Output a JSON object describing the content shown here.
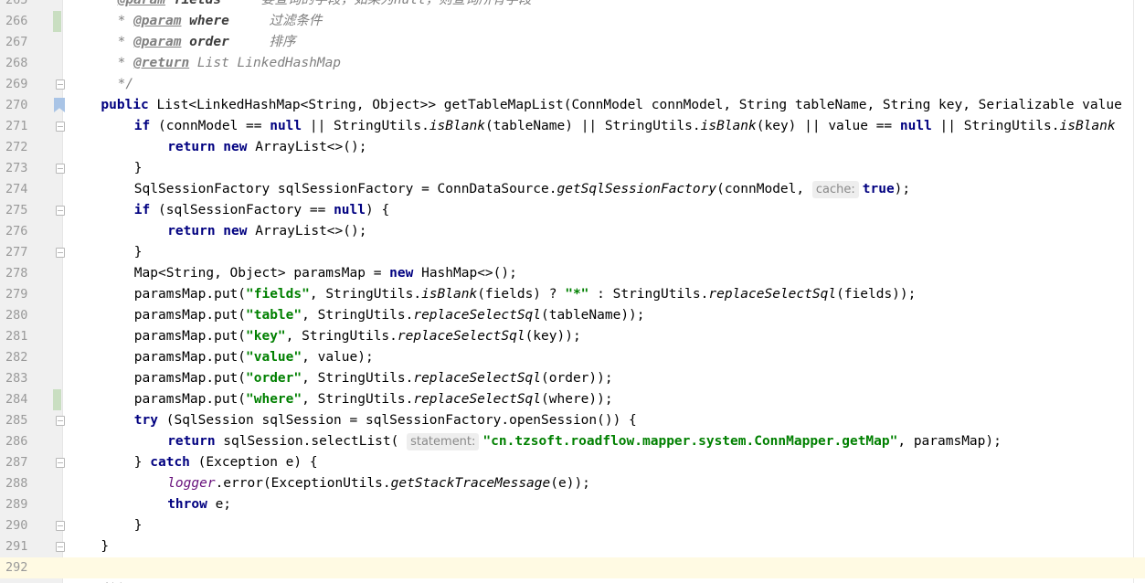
{
  "editor": {
    "lines": [
      {
        "n": "265",
        "vcs": false,
        "fold": "",
        "current": false,
        "indent": 3,
        "segments": [
          {
            "t": "tag",
            "v": "@param"
          },
          {
            "t": "tagp",
            "v": " fields"
          },
          {
            "t": "cm",
            "v": "     要查询的字段，如果为null，则查询所有字段"
          }
        ]
      },
      {
        "n": "266",
        "vcs": true,
        "fold": "",
        "current": false,
        "indent": 3,
        "segments": [
          {
            "t": "cm",
            "v": "* "
          },
          {
            "t": "tag",
            "v": "@param"
          },
          {
            "t": "tagp",
            "v": " where"
          },
          {
            "t": "cm",
            "v": "     过滤条件"
          }
        ]
      },
      {
        "n": "267",
        "vcs": false,
        "fold": "",
        "current": false,
        "indent": 3,
        "segments": [
          {
            "t": "cm",
            "v": "* "
          },
          {
            "t": "tag",
            "v": "@param"
          },
          {
            "t": "tagp",
            "v": " order"
          },
          {
            "t": "cm",
            "v": "     排序"
          }
        ]
      },
      {
        "n": "268",
        "vcs": false,
        "fold": "",
        "current": false,
        "indent": 3,
        "segments": [
          {
            "t": "cm",
            "v": "* "
          },
          {
            "t": "tag",
            "v": "@return"
          },
          {
            "t": "cm",
            "v": " List LinkedHashMap"
          }
        ]
      },
      {
        "n": "269",
        "vcs": false,
        "fold": "open",
        "current": false,
        "indent": 3,
        "segments": [
          {
            "t": "cm",
            "v": "*/"
          }
        ]
      },
      {
        "n": "270",
        "vcs": false,
        "fold": "bookmark",
        "current": false,
        "indent": 2,
        "segments": [
          {
            "t": "kw",
            "v": "public"
          },
          {
            "t": "p",
            "v": " List<LinkedHashMap<String, Object>> getTableMapList(ConnModel connModel, String tableName, String key, Serializable value"
          }
        ]
      },
      {
        "n": "271",
        "vcs": false,
        "fold": "open",
        "current": false,
        "indent": 4,
        "segments": [
          {
            "t": "kw",
            "v": "if"
          },
          {
            "t": "p",
            "v": " (connModel == "
          },
          {
            "t": "kw",
            "v": "null"
          },
          {
            "t": "p",
            "v": " || StringUtils."
          },
          {
            "t": "it",
            "v": "isBlank"
          },
          {
            "t": "p",
            "v": "(tableName) || StringUtils."
          },
          {
            "t": "it",
            "v": "isBlank"
          },
          {
            "t": "p",
            "v": "(key) || value == "
          },
          {
            "t": "kw",
            "v": "null"
          },
          {
            "t": "p",
            "v": " || StringUtils."
          },
          {
            "t": "it",
            "v": "isBlank"
          }
        ]
      },
      {
        "n": "272",
        "vcs": false,
        "fold": "",
        "current": false,
        "indent": 6,
        "segments": [
          {
            "t": "kw",
            "v": "return new"
          },
          {
            "t": "p",
            "v": " ArrayList<>();"
          }
        ]
      },
      {
        "n": "273",
        "vcs": false,
        "fold": "open",
        "current": false,
        "indent": 4,
        "segments": [
          {
            "t": "p",
            "v": "}"
          }
        ]
      },
      {
        "n": "274",
        "vcs": false,
        "fold": "",
        "current": false,
        "indent": 4,
        "segments": [
          {
            "t": "p",
            "v": "SqlSessionFactory sqlSessionFactory = ConnDataSource."
          },
          {
            "t": "it",
            "v": "getSqlSessionFactory"
          },
          {
            "t": "p",
            "v": "(connModel, "
          },
          {
            "t": "hint",
            "v": "cache:"
          },
          {
            "t": "kw",
            "v": "true"
          },
          {
            "t": "p",
            "v": ");"
          }
        ]
      },
      {
        "n": "275",
        "vcs": false,
        "fold": "open",
        "current": false,
        "indent": 4,
        "segments": [
          {
            "t": "kw",
            "v": "if"
          },
          {
            "t": "p",
            "v": " (sqlSessionFactory == "
          },
          {
            "t": "kw",
            "v": "null"
          },
          {
            "t": "p",
            "v": ") {"
          }
        ]
      },
      {
        "n": "276",
        "vcs": false,
        "fold": "",
        "current": false,
        "indent": 6,
        "segments": [
          {
            "t": "kw",
            "v": "return new"
          },
          {
            "t": "p",
            "v": " ArrayList<>();"
          }
        ]
      },
      {
        "n": "277",
        "vcs": false,
        "fold": "open",
        "current": false,
        "indent": 4,
        "segments": [
          {
            "t": "p",
            "v": "}"
          }
        ]
      },
      {
        "n": "278",
        "vcs": false,
        "fold": "",
        "current": false,
        "indent": 4,
        "segments": [
          {
            "t": "p",
            "v": "Map<String, Object> paramsMap = "
          },
          {
            "t": "kw",
            "v": "new"
          },
          {
            "t": "p",
            "v": " HashMap<>();"
          }
        ]
      },
      {
        "n": "279",
        "vcs": false,
        "fold": "",
        "current": false,
        "indent": 4,
        "segments": [
          {
            "t": "p",
            "v": "paramsMap.put("
          },
          {
            "t": "str",
            "v": "\"fields\""
          },
          {
            "t": "p",
            "v": ", StringUtils."
          },
          {
            "t": "it",
            "v": "isBlank"
          },
          {
            "t": "p",
            "v": "(fields) ? "
          },
          {
            "t": "str",
            "v": "\"*\""
          },
          {
            "t": "p",
            "v": " : StringUtils."
          },
          {
            "t": "it",
            "v": "replaceSelectSql"
          },
          {
            "t": "p",
            "v": "(fields));"
          }
        ]
      },
      {
        "n": "280",
        "vcs": false,
        "fold": "",
        "current": false,
        "indent": 4,
        "segments": [
          {
            "t": "p",
            "v": "paramsMap.put("
          },
          {
            "t": "str",
            "v": "\"table\""
          },
          {
            "t": "p",
            "v": ", StringUtils."
          },
          {
            "t": "it",
            "v": "replaceSelectSql"
          },
          {
            "t": "p",
            "v": "(tableName));"
          }
        ]
      },
      {
        "n": "281",
        "vcs": false,
        "fold": "",
        "current": false,
        "indent": 4,
        "segments": [
          {
            "t": "p",
            "v": "paramsMap.put("
          },
          {
            "t": "str",
            "v": "\"key\""
          },
          {
            "t": "p",
            "v": ", StringUtils."
          },
          {
            "t": "it",
            "v": "replaceSelectSql"
          },
          {
            "t": "p",
            "v": "(key));"
          }
        ]
      },
      {
        "n": "282",
        "vcs": false,
        "fold": "",
        "current": false,
        "indent": 4,
        "segments": [
          {
            "t": "p",
            "v": "paramsMap.put("
          },
          {
            "t": "str",
            "v": "\"value\""
          },
          {
            "t": "p",
            "v": ", value);"
          }
        ]
      },
      {
        "n": "283",
        "vcs": false,
        "fold": "",
        "current": false,
        "indent": 4,
        "segments": [
          {
            "t": "p",
            "v": "paramsMap.put("
          },
          {
            "t": "str",
            "v": "\"order\""
          },
          {
            "t": "p",
            "v": ", StringUtils."
          },
          {
            "t": "it",
            "v": "replaceSelectSql"
          },
          {
            "t": "p",
            "v": "(order));"
          }
        ]
      },
      {
        "n": "284",
        "vcs": true,
        "fold": "",
        "current": false,
        "indent": 4,
        "segments": [
          {
            "t": "p",
            "v": "paramsMap.put("
          },
          {
            "t": "str",
            "v": "\"where\""
          },
          {
            "t": "p",
            "v": ", StringUtils."
          },
          {
            "t": "it",
            "v": "replaceSelectSql"
          },
          {
            "t": "p",
            "v": "(where));"
          }
        ]
      },
      {
        "n": "285",
        "vcs": false,
        "fold": "open",
        "current": false,
        "indent": 4,
        "segments": [
          {
            "t": "kw",
            "v": "try"
          },
          {
            "t": "p",
            "v": " (SqlSession sqlSession = sqlSessionFactory.openSession()) {"
          }
        ]
      },
      {
        "n": "286",
        "vcs": false,
        "fold": "",
        "current": false,
        "indent": 6,
        "segments": [
          {
            "t": "kw",
            "v": "return"
          },
          {
            "t": "p",
            "v": " sqlSession.selectList( "
          },
          {
            "t": "hint",
            "v": "statement:"
          },
          {
            "t": "str",
            "v": "\"cn.tzsoft.roadflow.mapper.system.ConnMapper.getMap\""
          },
          {
            "t": "p",
            "v": ", paramsMap);"
          }
        ]
      },
      {
        "n": "287",
        "vcs": false,
        "fold": "open",
        "current": false,
        "indent": 4,
        "segments": [
          {
            "t": "p",
            "v": "} "
          },
          {
            "t": "kw",
            "v": "catch"
          },
          {
            "t": "p",
            "v": " (Exception e) {"
          }
        ]
      },
      {
        "n": "288",
        "vcs": false,
        "fold": "",
        "current": false,
        "indent": 6,
        "segments": [
          {
            "t": "field",
            "v": "logger"
          },
          {
            "t": "p",
            "v": ".error(ExceptionUtils."
          },
          {
            "t": "it",
            "v": "getStackTraceMessage"
          },
          {
            "t": "p",
            "v": "(e));"
          }
        ]
      },
      {
        "n": "289",
        "vcs": false,
        "fold": "",
        "current": false,
        "indent": 6,
        "segments": [
          {
            "t": "kw",
            "v": "throw"
          },
          {
            "t": "p",
            "v": " e;"
          }
        ]
      },
      {
        "n": "290",
        "vcs": false,
        "fold": "open",
        "current": false,
        "indent": 4,
        "segments": [
          {
            "t": "p",
            "v": "}"
          }
        ]
      },
      {
        "n": "291",
        "vcs": false,
        "fold": "open",
        "current": false,
        "indent": 2,
        "segments": [
          {
            "t": "p",
            "v": "}"
          }
        ]
      },
      {
        "n": "292",
        "vcs": false,
        "fold": "",
        "current": true,
        "indent": 2,
        "segments": []
      },
      {
        "n": "",
        "vcs": false,
        "fold": "",
        "current": false,
        "indent": 2,
        "segments": [
          {
            "t": "cm",
            "v": "/**"
          }
        ]
      }
    ]
  }
}
